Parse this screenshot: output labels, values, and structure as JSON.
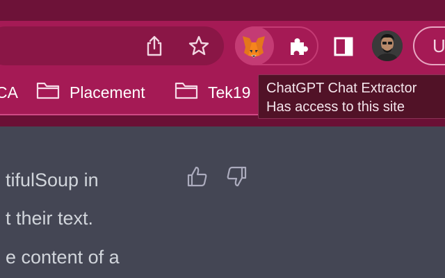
{
  "toolbar": {
    "profile_initial": "U",
    "icons": [
      "share-icon",
      "bookmark-star-icon",
      "metamask-fox-icon",
      "extensions-puzzle-icon",
      "side-panel-icon",
      "avatar"
    ]
  },
  "bookmarks": {
    "items": [
      {
        "label": "CA"
      },
      {
        "label": "Placement"
      },
      {
        "label": "Tek19"
      }
    ]
  },
  "tooltip": {
    "title": "ChatGPT Chat Extractor",
    "subtitle": "Has access to this site"
  },
  "message": {
    "lines": [
      "tifulSoup in",
      "t their text.",
      "e content of a"
    ]
  },
  "colors": {
    "toolbar_bg": "#a51a55",
    "tab_strip_bg": "#6d1238",
    "content_bg": "#444654",
    "tooltip_bg": "#511227"
  }
}
